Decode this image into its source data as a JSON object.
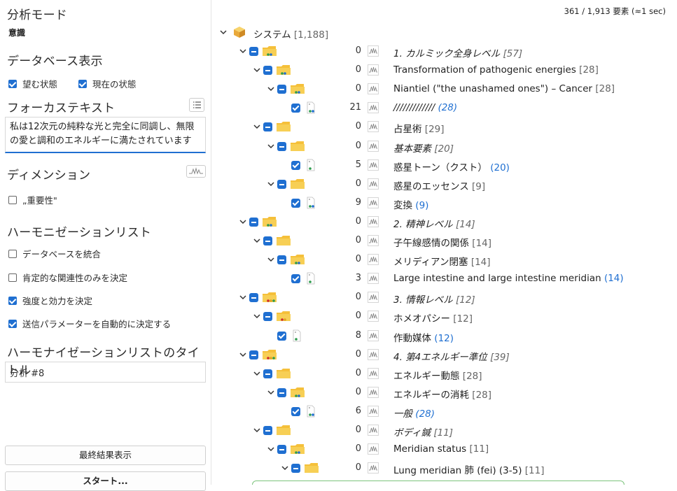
{
  "left": {
    "analysis_mode_title": "分析モード",
    "analysis_mode_value": "意識",
    "db_view_title": "データベース表示",
    "desired_state": "望む状態",
    "current_state": "現在の状態",
    "focus_text_title": "フォーカステキスト",
    "focus_text_value": "私は12次元の純粋な光と完全に同調し、無限の愛と調和のエネルギーに満たされています",
    "dimension_title": "ディメンション",
    "importance": "„重要性\"",
    "harmonization_title": "ハーモニゼーションリスト",
    "opt_merge_db": "データベースを統合",
    "opt_positive_only": "肯定的な関連性のみを決定",
    "opt_intensity": "強度と効力を決定",
    "opt_auto_params": "送信パラメーターを自動的に決定する",
    "list_title_heading": "ハーモナイゼーションリストのタイトル",
    "list_title_value": "分析 #8",
    "show_results_button": "最終結果表示",
    "start_button": "スタート..."
  },
  "right": {
    "status": "361 / 1,913 要素 (≈1 sec)",
    "root": {
      "label": "システム",
      "count": "[1,188]"
    },
    "rows": [
      {
        "indent": 0,
        "type": "folder",
        "dots": [
          "#2e9c4d",
          "#1f6fd1"
        ],
        "num": "0",
        "label": "1. カルミック全身レベル",
        "italic": true,
        "count": "[57]",
        "count_blue": false
      },
      {
        "indent": 1,
        "type": "folder",
        "dots": [
          "#2e9c4d",
          "#1f6fd1"
        ],
        "num": "0",
        "label": "Transformation of pathogenic energies",
        "italic": false,
        "count": "[28]",
        "count_blue": false
      },
      {
        "indent": 2,
        "type": "folder",
        "dots": [
          "#2e9c4d",
          "#1f6fd1"
        ],
        "num": "0",
        "label": "Niantiel (\"the unashamed ones\") – Cancer",
        "italic": false,
        "count": "[28]",
        "count_blue": false
      },
      {
        "indent": 3,
        "type": "doc",
        "dots": [
          "#2e9c4d",
          "#1f6fd1"
        ],
        "num": "21",
        "label": "/////////////",
        "italic": true,
        "count": "(28)",
        "count_blue": true
      },
      {
        "indent": 1,
        "type": "folder",
        "dots": [],
        "num": "0",
        "label": "占星術",
        "italic": false,
        "count": "[29]",
        "count_blue": false
      },
      {
        "indent": 2,
        "type": "folder",
        "dots": [],
        "num": "0",
        "label": "基本要素",
        "italic": true,
        "count": "[20]",
        "count_blue": false
      },
      {
        "indent": 3,
        "type": "doc",
        "dots": [
          "#2e9c4d"
        ],
        "num": "5",
        "label": "惑星トーン（クスト）",
        "italic": false,
        "count": "(20)",
        "count_blue": true
      },
      {
        "indent": 2,
        "type": "folder",
        "dots": [],
        "num": "0",
        "label": "惑星のエッセンス",
        "italic": false,
        "count": "[9]",
        "count_blue": false
      },
      {
        "indent": 3,
        "type": "doc",
        "dots": [
          "#2e9c4d",
          "#1f6fd1"
        ],
        "num": "9",
        "label": "変換",
        "italic": false,
        "count": "(9)",
        "count_blue": true
      },
      {
        "indent": 0,
        "type": "folder",
        "dots": [
          "#2e9c4d",
          "#1f6fd1"
        ],
        "num": "0",
        "label": "2. 精神レベル",
        "italic": true,
        "count": "[14]",
        "count_blue": false
      },
      {
        "indent": 1,
        "type": "folder",
        "dots": [],
        "num": "0",
        "label": "子午線感情の関係",
        "italic": false,
        "count": "[14]",
        "count_blue": false
      },
      {
        "indent": 2,
        "type": "folder",
        "dots": [
          "#2e9c4d",
          "#1f6fd1"
        ],
        "num": "0",
        "label": "メリディアン閉塞",
        "italic": false,
        "count": "[14]",
        "count_blue": false
      },
      {
        "indent": 3,
        "type": "doc",
        "dots": [
          "#2e9c4d"
        ],
        "num": "3",
        "label": "Large intestine and large intestine meridian",
        "italic": false,
        "count": "(14)",
        "count_blue": true
      },
      {
        "indent": 0,
        "type": "folder",
        "dots": [
          "#d02b2b",
          "#e0a020",
          "#2e9c4d"
        ],
        "num": "0",
        "label": "3. 情報レベル",
        "italic": true,
        "count": "[12]",
        "count_blue": false
      },
      {
        "indent": 1,
        "type": "folder",
        "dots": [
          "#d02b2b",
          "#e0a020"
        ],
        "num": "0",
        "label": "ホメオパシー",
        "italic": false,
        "count": "[12]",
        "count_blue": false
      },
      {
        "indent": 2,
        "type": "doc",
        "dots": [
          "#2e9c4d"
        ],
        "num": "8",
        "label": "作動媒体",
        "italic": false,
        "count": "(12)",
        "count_blue": true
      },
      {
        "indent": 0,
        "type": "folder",
        "dots": [
          "#d02b2b",
          "#e0a020",
          "#2e9c4d"
        ],
        "num": "0",
        "label": "4. 第4エネルギー準位",
        "italic": true,
        "count": "[39]",
        "count_blue": false
      },
      {
        "indent": 1,
        "type": "folder",
        "dots": [],
        "num": "0",
        "label": "エネルギー動態",
        "italic": false,
        "count": "[28]",
        "count_blue": false
      },
      {
        "indent": 2,
        "type": "folder",
        "dots": [
          "#2e9c4d",
          "#1f6fd1"
        ],
        "num": "0",
        "label": "エネルギーの消耗",
        "italic": false,
        "count": "[28]",
        "count_blue": false
      },
      {
        "indent": 3,
        "type": "doc",
        "dots": [
          "#2e9c4d",
          "#1f6fd1"
        ],
        "num": "6",
        "label": "一般",
        "italic": true,
        "count": "(28)",
        "count_blue": true
      },
      {
        "indent": 1,
        "type": "folder",
        "dots": [],
        "num": "0",
        "label": "ボディ鍼",
        "italic": true,
        "count": "[11]",
        "count_blue": false
      },
      {
        "indent": 2,
        "type": "folder",
        "dots": [
          "#2e9c4d",
          "#1f6fd1"
        ],
        "num": "0",
        "label": "Meridian status",
        "italic": false,
        "count": "[11]",
        "count_blue": false
      },
      {
        "indent": 3,
        "type": "folder",
        "dots": [],
        "num": "0",
        "label": "Lung meridian 肺 (fei) (3-5)",
        "italic": false,
        "count": "[11]",
        "count_blue": false
      }
    ]
  },
  "colors": {
    "accent": "#1f6fd1",
    "folder": "#f5c03a"
  }
}
